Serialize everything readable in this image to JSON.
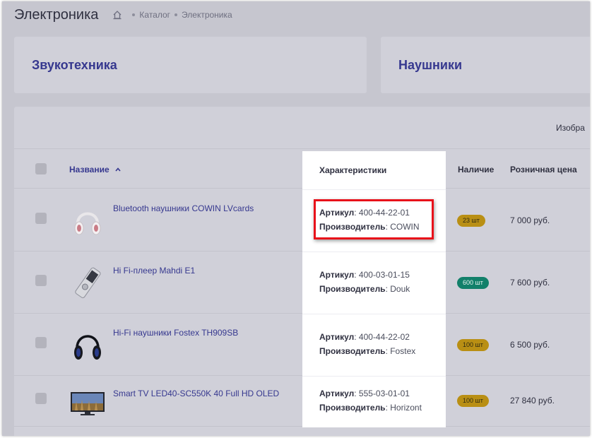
{
  "header": {
    "title": "Электроника",
    "breadcrumb": [
      "Каталог",
      "Электроника"
    ]
  },
  "categories": [
    "Звукотехника",
    "Наушники"
  ],
  "toolbar": {
    "label": "Изобра"
  },
  "table": {
    "columns": {
      "name": "Название",
      "characteristics": "Характеристики",
      "availability": "Наличие",
      "price": "Розничная цена"
    },
    "rows": [
      {
        "name": "Bluetooth наушники COWIN LVcards",
        "article_label": "Артикул",
        "article": ": 400-44-22-01",
        "maker_label": "Производитель",
        "maker": ": COWIN",
        "stock": "23 шт",
        "price": "7 000 руб."
      },
      {
        "name": "Hi Fi-плеер Mahdi E1",
        "article_label": "Артикул",
        "article": ": 400-03-01-15",
        "maker_label": "Производитель",
        "maker": ": Douk",
        "stock": "600 шт",
        "price": "7 600 руб."
      },
      {
        "name": "Hi-Fi наушники Fostex TH909SB",
        "article_label": "Артикул",
        "article": ": 400-44-22-02",
        "maker_label": "Производитель",
        "maker": ": Fostex",
        "stock": "100 шт",
        "price": "6 500 руб."
      },
      {
        "name": "Smart TV LED40-SC550K 40 Full HD OLED",
        "article_label": "Артикул",
        "article": ": 555-03-01-01",
        "maker_label": "Производитель",
        "maker": ": Horizont",
        "stock": "100 шт",
        "price": "27 840 руб."
      }
    ]
  },
  "colors": {
    "overlay": "#c6c6cf",
    "link": "#36388f",
    "highlight": "#e8111a",
    "badge_yellow": "#b98f14",
    "badge_green": "#12806a"
  },
  "icons": [
    "home-icon",
    "sort-up-icon",
    "checkbox",
    "product-thumbnail"
  ]
}
